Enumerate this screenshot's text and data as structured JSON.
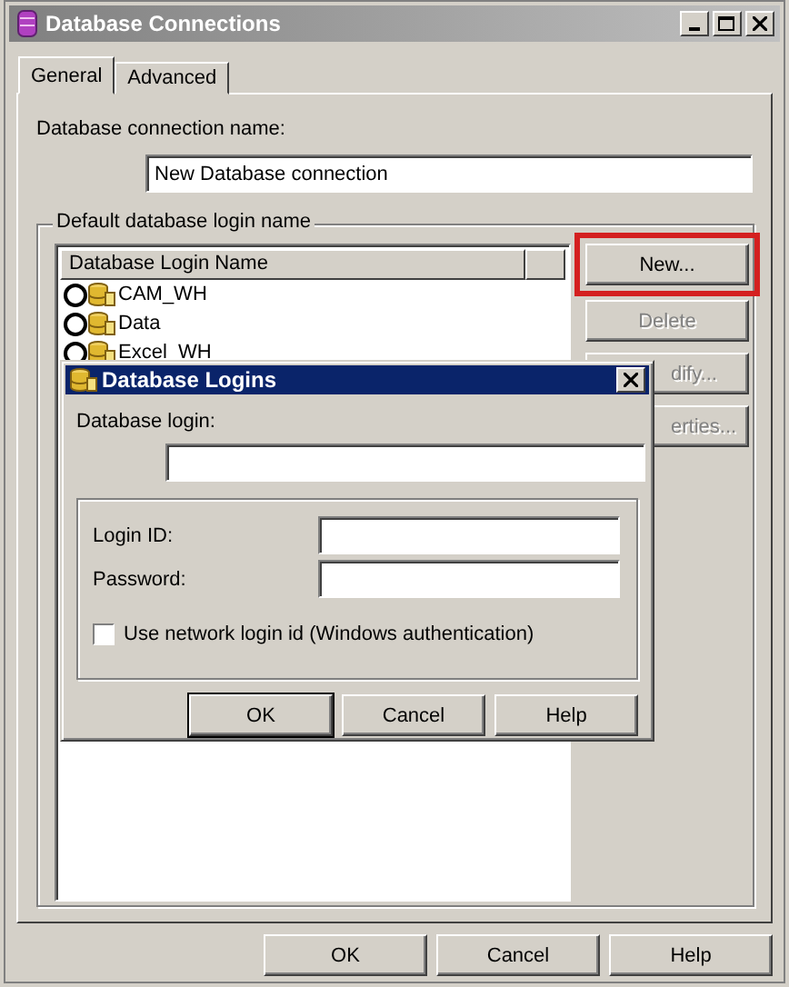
{
  "window": {
    "title": "Database Connections",
    "active": false
  },
  "tabs": [
    {
      "label": "General",
      "selected": true
    },
    {
      "label": "Advanced",
      "selected": false
    }
  ],
  "connection_name": {
    "label": "Database connection name:",
    "value": "New Database connection"
  },
  "login_group": {
    "title": "Default database login name",
    "columns": [
      "Database Login Name"
    ],
    "logins": [
      {
        "name": "CAM_WH",
        "selected": false
      },
      {
        "name": "Data",
        "selected": false
      },
      {
        "name": "Excel_WH",
        "selected": false
      }
    ],
    "buttons": [
      {
        "label": "New...",
        "disabled": false,
        "highlighted": true,
        "covered": false
      },
      {
        "label": "Delete",
        "disabled": true,
        "highlighted": false,
        "covered": false
      },
      {
        "label": "dify...",
        "disabled": true,
        "highlighted": false,
        "covered": true
      },
      {
        "label": "erties...",
        "disabled": true,
        "highlighted": false,
        "covered": true
      }
    ]
  },
  "buttons": [
    {
      "label": "OK",
      "default": false
    },
    {
      "label": "Cancel",
      "default": false
    },
    {
      "label": "Help",
      "default": false
    }
  ],
  "dialog": {
    "title": "Database Logins",
    "login_label": "Database login:",
    "fields": [
      {
        "label": "Login ID:"
      },
      {
        "label": "Password:"
      }
    ],
    "network_login": {
      "label": "Use network login id (Windows authentication)",
      "checked": false
    },
    "buttons": [
      {
        "label": "OK",
        "default": true
      },
      {
        "label": "Cancel",
        "default": false
      },
      {
        "label": "Help",
        "default": false
      }
    ]
  }
}
